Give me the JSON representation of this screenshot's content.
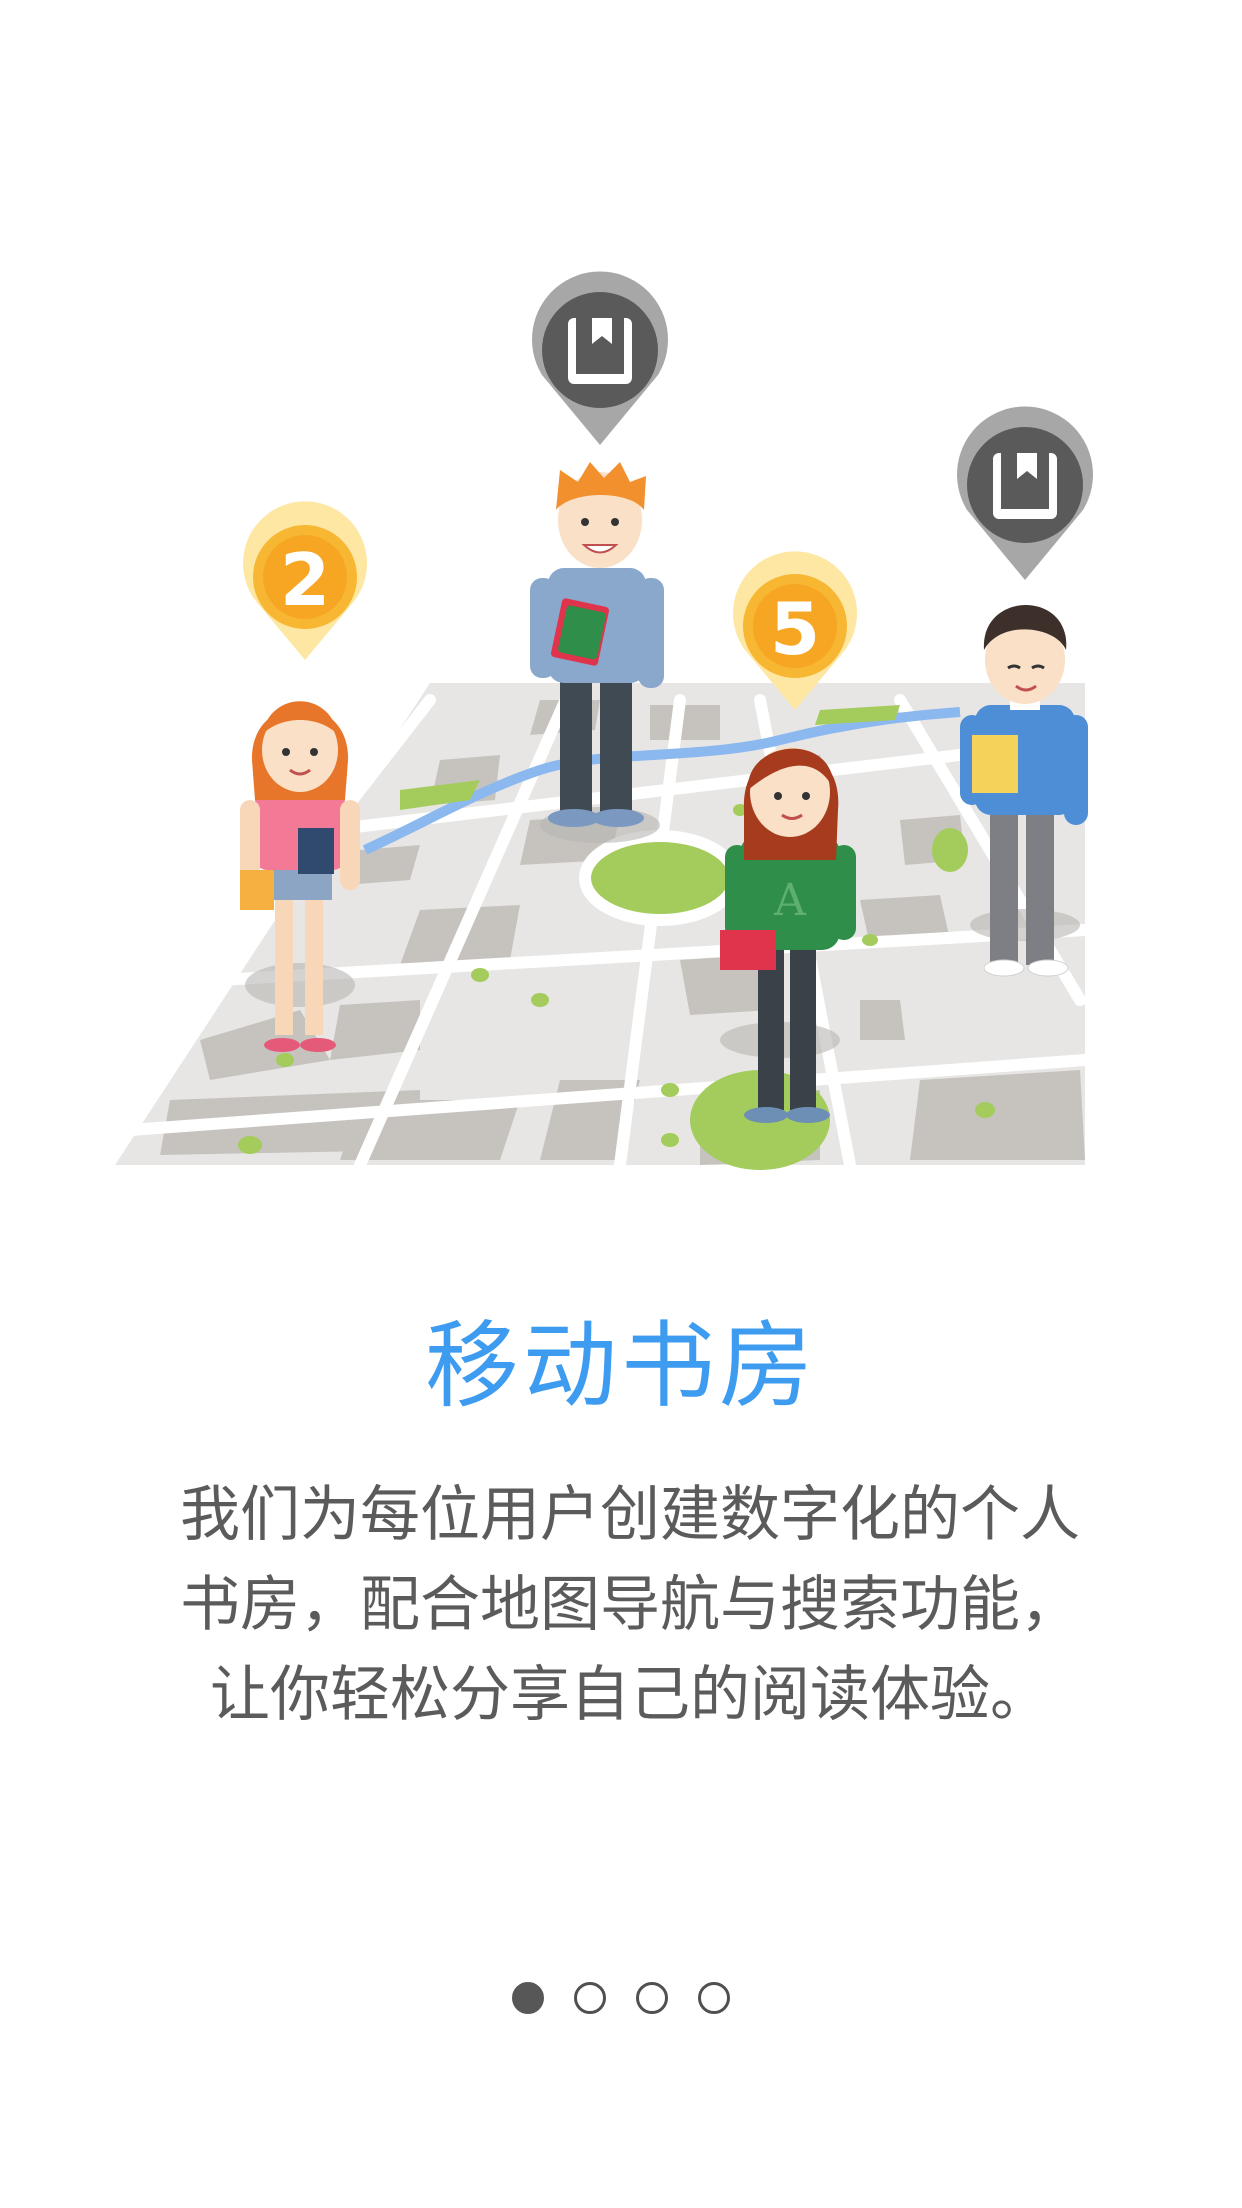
{
  "onboarding": {
    "title": "移动书房",
    "description_lines": [
      "我们为每位用户创建数字化的个人",
      "书房，配合地图导航与搜索功能，",
      "让你轻松分享自己的阅读体验。"
    ],
    "page_indicator": {
      "total": 4,
      "current": 1
    }
  },
  "illustration": {
    "pins": [
      {
        "label": "2",
        "type": "number-pin"
      },
      {
        "label": "5",
        "type": "number-pin"
      },
      {
        "type": "book-pin"
      },
      {
        "type": "book-pin"
      }
    ],
    "shirt_letter": "A"
  },
  "colors": {
    "accent": "#3d9bf0",
    "pin_yellow": "#f7b733",
    "pin_gray": "#5a5a5a",
    "map_base": "#e7e6e4",
    "map_blocks": "#c6c3bf",
    "map_green": "#a4cc5c"
  }
}
